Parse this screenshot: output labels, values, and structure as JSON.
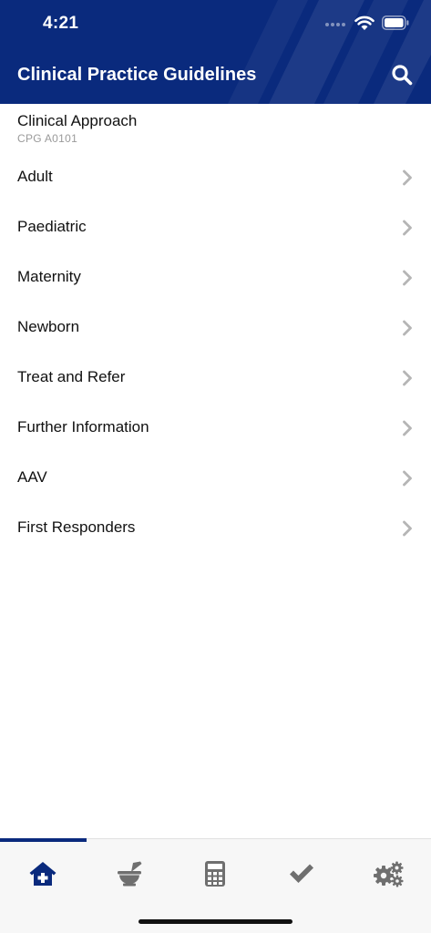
{
  "status": {
    "time": "4:21"
  },
  "header": {
    "title": "Clinical Practice Guidelines"
  },
  "list": {
    "first": {
      "title": "Clinical Approach",
      "subtitle": "CPG A0101"
    },
    "items": [
      {
        "label": "Adult"
      },
      {
        "label": "Paediatric"
      },
      {
        "label": "Maternity"
      },
      {
        "label": "Newborn"
      },
      {
        "label": "Treat and Refer"
      },
      {
        "label": "Further Information"
      },
      {
        "label": "AAV"
      },
      {
        "label": "First Responders"
      }
    ]
  },
  "tabbar": {
    "active": "home",
    "tabs": [
      {
        "icon": "home-plus-icon"
      },
      {
        "icon": "mortar-pestle-icon"
      },
      {
        "icon": "calculator-icon"
      },
      {
        "icon": "checkmark-icon"
      },
      {
        "icon": "gears-icon"
      }
    ]
  },
  "colors": {
    "header_bg": "#0a2a7d",
    "active_tab": "#0a2a7d",
    "inactive_tab": "#6f6f6f",
    "chevron": "#b5b5b5"
  }
}
